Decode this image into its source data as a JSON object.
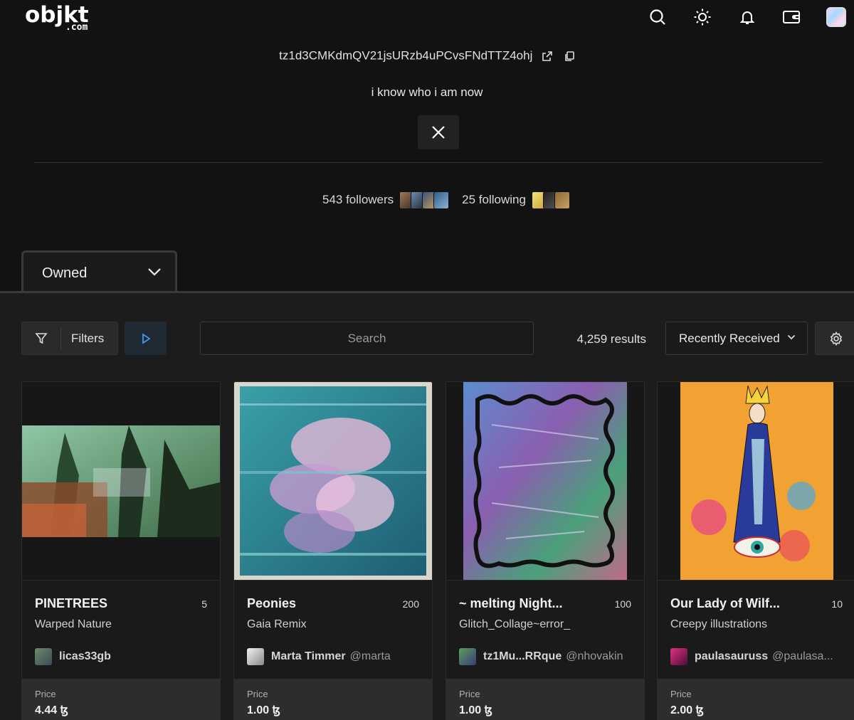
{
  "header": {
    "logo_main": "objkt",
    "logo_sub": ".com",
    "icons": [
      "search-icon",
      "sun-icon",
      "bell-icon",
      "wallet-icon"
    ]
  },
  "profile": {
    "address": "tz1d3CMKdmQV21jsURzb4uPCvsFNdTTZ4ohj",
    "bio": "i know who i am now",
    "followers_label": "543 followers",
    "following_label": "25 following"
  },
  "tabs": {
    "active": "Owned"
  },
  "toolbar": {
    "filters_label": "Filters",
    "search_placeholder": "Search",
    "results_label": "4,259 results",
    "sort_label": "Recently Received"
  },
  "cards": [
    {
      "title": "PINETREES",
      "editions": "5",
      "collection": "Warped Nature",
      "creator_name": "licas33gb",
      "creator_handle": "",
      "price_label": "Price",
      "price": "4.44 ꜩ"
    },
    {
      "title": "Peonies",
      "editions": "200",
      "collection": "Gaia Remix",
      "creator_name": "Marta Timmer",
      "creator_handle": "@marta",
      "price_label": "Price",
      "price": "1.00 ꜩ"
    },
    {
      "title": "~ melting Night...",
      "editions": "100",
      "collection": "Glitch_Collage~error_",
      "creator_name": "tz1Mu...RRque",
      "creator_handle": "@nhovakin",
      "price_label": "Price",
      "price": "1.00 ꜩ"
    },
    {
      "title": "Our Lady of Wilf...",
      "editions": "10",
      "collection": "Creepy illustrations",
      "creator_name": "paulasauruss",
      "creator_handle": "@paulasa...",
      "price_label": "Price",
      "price": "2.00 ꜩ"
    }
  ],
  "colors": {
    "page_bg": "#121212",
    "content_bg": "#1c1c1c",
    "accent_play": "#4aa3ff"
  }
}
